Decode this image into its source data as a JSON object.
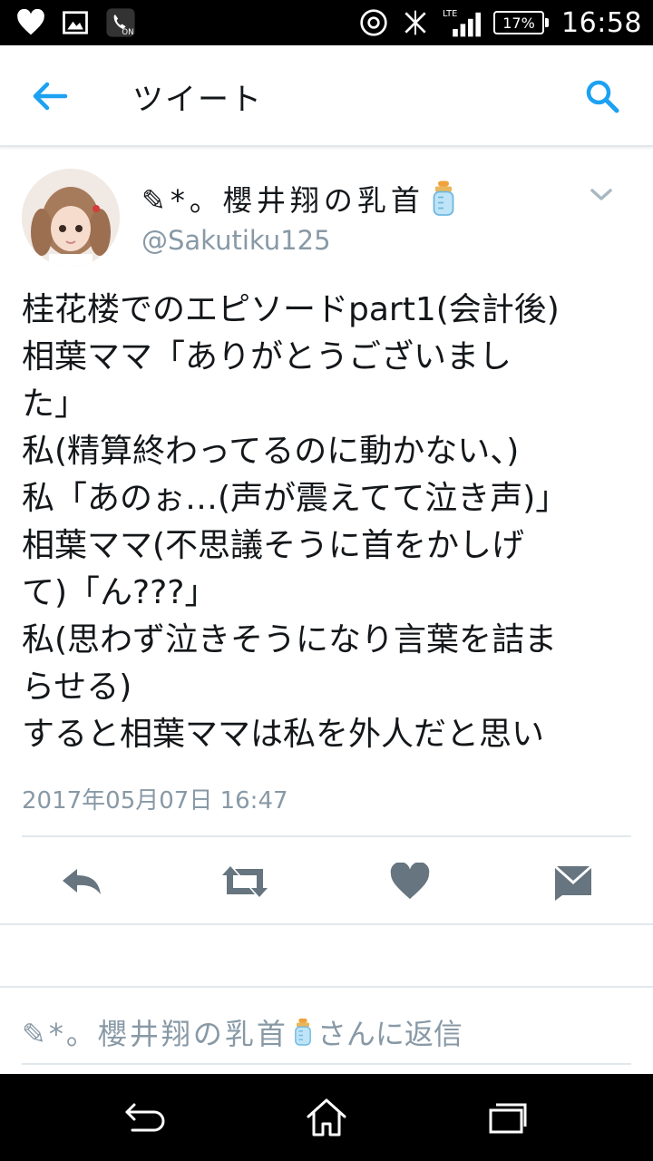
{
  "status_bar": {
    "battery_label": "17%",
    "battery_level": 0.17,
    "network_label": "LTE",
    "time": "16:58",
    "icons": [
      "heart-icon",
      "image-icon",
      "call-recording-icon",
      "data-saver-icon",
      "vibrate-off-icon",
      "signal-icon",
      "battery-icon"
    ]
  },
  "app_bar": {
    "title": "ツイート",
    "icons": [
      "back-arrow-icon",
      "search-icon"
    ]
  },
  "tweet": {
    "author": {
      "prefix": "✎*。",
      "name": "櫻井翔の乳首",
      "name_icon": "baby-bottle-icon",
      "handle": "@Sakutiku125"
    },
    "lines": [
      "桂花楼でのエピソードpart1(会計後)",
      "相葉ママ「ありがとうございまし",
      "た」",
      "私(精算終わってるのに動かない、)",
      "私「あのぉ…(声が震えてて泣き声)」",
      "相葉ママ(不思議そうに首をかしげ",
      "て)「ん???」",
      "私(思わず泣きそうになり言葉を詰ま",
      "らせる)",
      "すると相葉ママは私を外人だと思い"
    ],
    "timestamp": "2017年05月07日 16:47"
  },
  "actions": {
    "icons": [
      "reply-icon",
      "retweet-icon",
      "like-heart-icon",
      "direct-message-icon"
    ]
  },
  "reply": {
    "prefix": "✎*。",
    "name": "櫻井翔の乳首",
    "name_icon": "baby-bottle-icon",
    "suffix": "さんに返信"
  },
  "nav_bar": {
    "icons": [
      "back-nav-icon",
      "home-nav-icon",
      "recents-nav-icon"
    ]
  },
  "colors": {
    "accent": "#1da1f2",
    "secondary_text": "#8899a6",
    "action_icon": "#66757f",
    "divider": "#e1e8ed"
  }
}
